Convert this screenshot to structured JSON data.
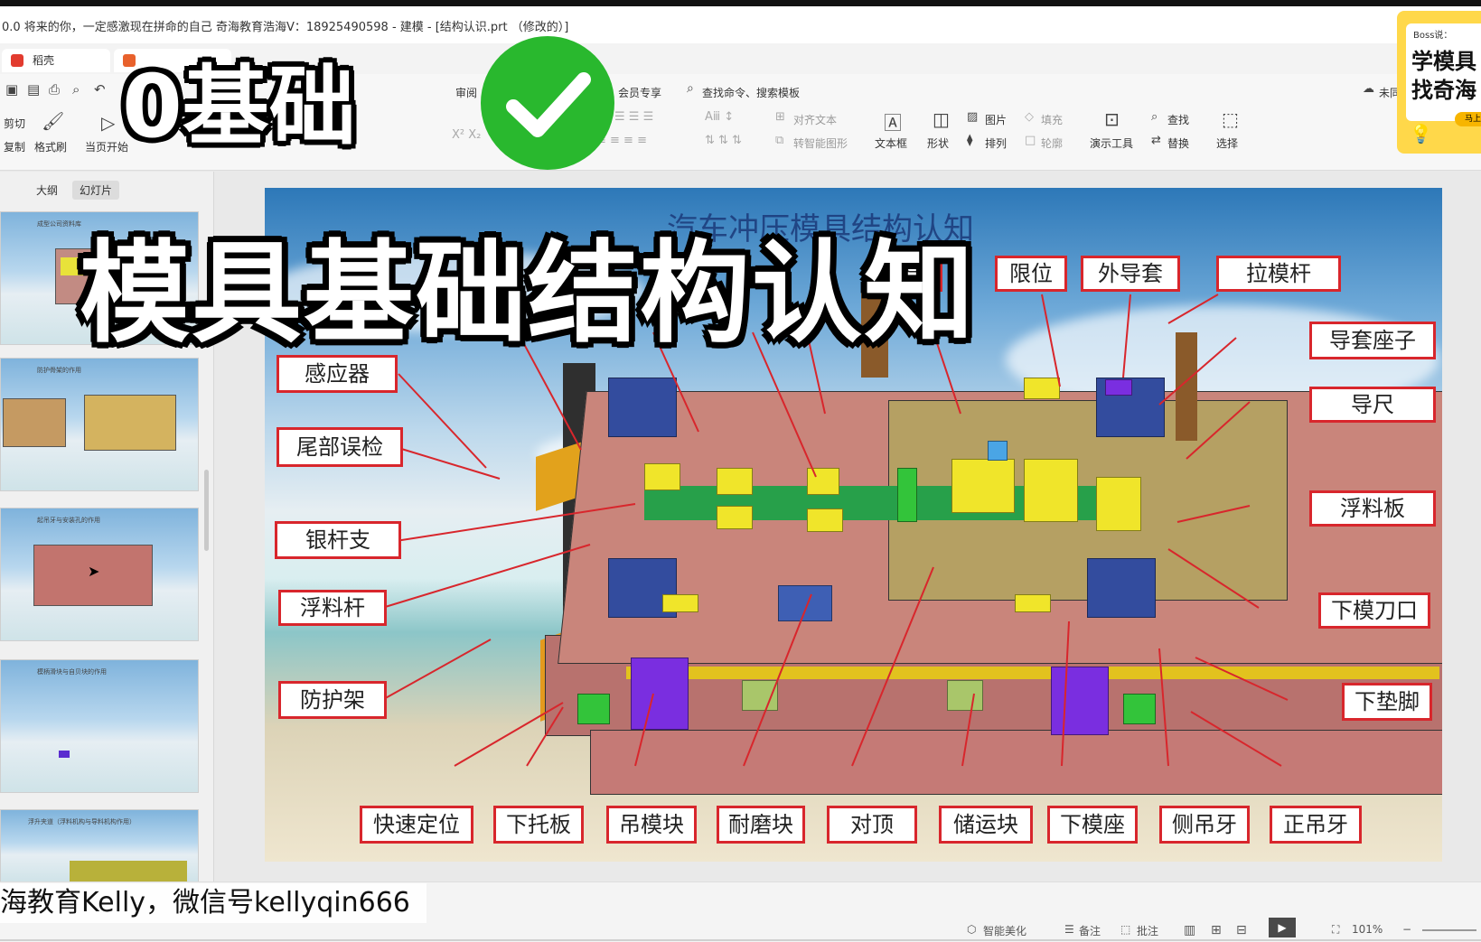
{
  "window": {
    "title": "0.0 将来的你，一定感激现在拼命的自己 奇海教育浩海V：18925490598 - 建模 - [结构认识.prt （修改的）]"
  },
  "tabs": [
    {
      "label": "稻壳",
      "color": "#e23b2f"
    },
    {
      "label": "",
      "color": "#e8612c"
    }
  ],
  "ribbon": {
    "menu": [
      "审阅",
      "会员专享"
    ],
    "search_placeholder": "查找命令、搜索模板",
    "unsync": "未同",
    "clipboard": {
      "cut": "剪切",
      "copy": "复制",
      "format_painter": "格式刷",
      "start_from": "当页开始"
    },
    "align_text": "对齐文本",
    "smart_shape": "转智能图形",
    "textbox": "文本框",
    "shape": "形状",
    "picture": "图片",
    "arrange": "排列",
    "fill": "填充",
    "outline": "轮廓",
    "presenter_tools": "演示工具",
    "find": "查找",
    "replace": "替换",
    "select": "选择"
  },
  "left_panel": {
    "tabs": [
      "大纲",
      "幻灯片"
    ],
    "thumbnails": [
      {
        "caption": "成型公司资料库"
      },
      {
        "caption": "防护骨架的作用"
      },
      {
        "caption": "起吊牙与安装孔的作用"
      },
      {
        "caption": "模柄滑块与自贝块的作用"
      },
      {
        "caption": "浮升夹道（浮料机构与导料机构作用）"
      }
    ]
  },
  "slide": {
    "title": "汽车冲压模具结构认知",
    "labels_left": [
      "感应器",
      "尾部误检",
      "银杆支",
      "浮料杆",
      "防护架"
    ],
    "labels_top": [
      "限位",
      "外导套",
      "拉模杆",
      "导"
    ],
    "labels_right": [
      "导套座子",
      "导尺",
      "浮料板",
      "下模刀口",
      "下垫脚"
    ],
    "labels_bottom": [
      "快速定位",
      "下托板",
      "吊模块",
      "耐磨块",
      "对顶",
      "储运块",
      "下模座",
      "侧吊牙",
      "正吊牙"
    ]
  },
  "overlay": {
    "line1": "0基础",
    "line2": "模具基础结构认知",
    "check_icon": "check-circle-icon"
  },
  "ad_card": {
    "line1": "Boss说：",
    "line2": "学模具",
    "line3": "找奇海",
    "button": "马上"
  },
  "footer": {
    "watermark": "海教育Kelly，微信号kellyqin666",
    "smart_beautify": "智能美化",
    "notes": "备注",
    "comments": "批注",
    "zoom": "101%"
  },
  "colors": {
    "label_border": "#d8262c",
    "check_green": "#29b82e",
    "ad_yellow": "#ffd84a"
  }
}
